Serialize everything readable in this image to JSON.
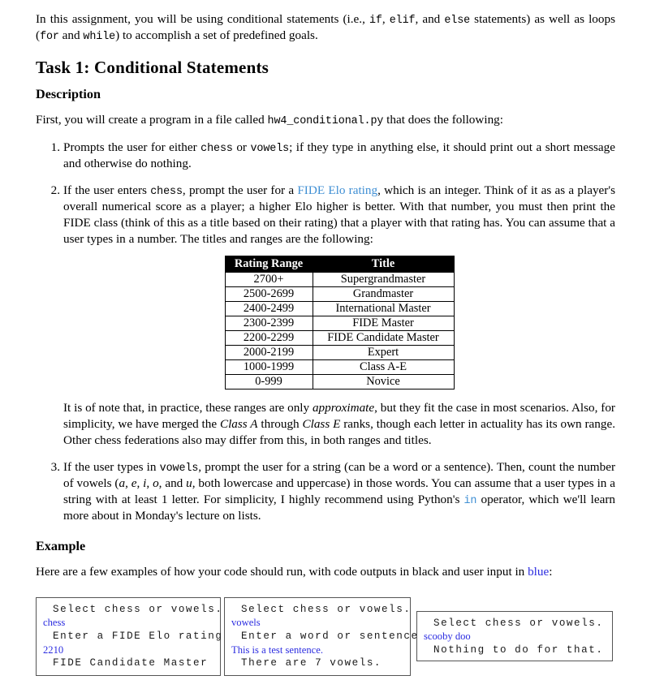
{
  "intro": {
    "part1": "In this assignment, you will be using conditional statements (i.e., ",
    "kw_if": "if",
    "sep1": ", ",
    "kw_elif": "elif",
    "sep2": ", and ",
    "kw_else": "else",
    "part2": " statements) as well as loops (",
    "kw_for": "for",
    "sep3": " and ",
    "kw_while": "while",
    "part3": ") to accomplish a set of predefined goals."
  },
  "task": {
    "title": "Task 1: Conditional Statements",
    "description_heading": "Description",
    "description_intro_a": "First, you will create a program in a file called ",
    "description_file": "hw4_conditional.py",
    "description_intro_b": " that does the following:"
  },
  "items": {
    "item1": {
      "a": "Prompts the user for either ",
      "kw1": "chess",
      "b": " or ",
      "kw2": "vowels",
      "c": "; if they type in anything else, it should print out a short message and otherwise do nothing."
    },
    "item2": {
      "a": "If the user enters ",
      "kw1": "chess",
      "b": ", prompt the user for a ",
      "link": "FIDE Elo rating",
      "c": ", which is an integer. Think of it as as a player's overall numerical score as a player; a higher Elo higher is better. With that number, you must then print the FIDE class (think of this as a title based on their rating) that a player with that rating has. You can assume that a user types in a number. The titles and ranges are the following:"
    },
    "item3": {
      "a": "If the user types in ",
      "kw1": "vowels",
      "b": ", prompt the user for a string (can be a word or a sentence). Then, count the number of vowels (",
      "v1": "a",
      "v2": "e",
      "v3": "i",
      "v4": "o",
      "v5": "u",
      "c": ", both lowercase and uppercase) in those words. You can assume that a user types in a string with at least 1 letter. For simplicity, I highly recommend using Python's ",
      "kw_in": "in",
      "d": " operator, which we'll learn more about in Monday's lecture on lists."
    }
  },
  "table": {
    "headers": [
      "Rating Range",
      "Title"
    ],
    "rows": [
      [
        "2700+",
        "Supergrandmaster"
      ],
      [
        "2500-2699",
        "Grandmaster"
      ],
      [
        "2400-2499",
        "International Master"
      ],
      [
        "2300-2399",
        "FIDE Master"
      ],
      [
        "2200-2299",
        "FIDE Candidate Master"
      ],
      [
        "2000-2199",
        "Expert"
      ],
      [
        "1000-1999",
        "Class A-E"
      ],
      [
        "0-999",
        "Novice"
      ]
    ]
  },
  "note": {
    "a": "It is of note that, in practice, these ranges are only ",
    "em1": "approximate",
    "b": ", but they fit the case in most scenarios. Also, for simplicity, we have merged the ",
    "em2": "Class A",
    "c": " through ",
    "em3": "Class E",
    "d": " ranks, though each letter in actuality has its own range. Other chess federations also may differ from this, in both ranges and titles."
  },
  "example": {
    "heading": "Example",
    "intro_a": "Here are a few examples of how your code should run, with code outputs in black and user input in ",
    "intro_blue": "blue",
    "intro_b": ":"
  },
  "boxes": [
    {
      "name": "chess-example",
      "lines": [
        {
          "text": "Select chess or vowels.",
          "kind": "output"
        },
        {
          "text": "chess",
          "kind": "input"
        },
        {
          "text": "Enter a FIDE Elo rating.",
          "kind": "output"
        },
        {
          "text": "2210",
          "kind": "input"
        },
        {
          "text": "FIDE Candidate Master",
          "kind": "output"
        }
      ]
    },
    {
      "name": "vowels-example",
      "lines": [
        {
          "text": "Select chess or vowels.",
          "kind": "output"
        },
        {
          "text": "vowels",
          "kind": "input"
        },
        {
          "text": "Enter a word or sentence.",
          "kind": "output"
        },
        {
          "text": "This is a test sentence.",
          "kind": "input"
        },
        {
          "text": "There are 7 vowels.",
          "kind": "output"
        }
      ]
    },
    {
      "name": "invalid-example",
      "lines": [
        {
          "text": "Select chess or vowels.",
          "kind": "output"
        },
        {
          "text": "scooby doo",
          "kind": "input"
        },
        {
          "text": "Nothing to do for that.",
          "kind": "output"
        }
      ]
    }
  ],
  "colors": {
    "link": "#3f8fd4",
    "user_input": "#2b2ce0",
    "table_header_bg": "#000000",
    "box_border": "#555555"
  }
}
